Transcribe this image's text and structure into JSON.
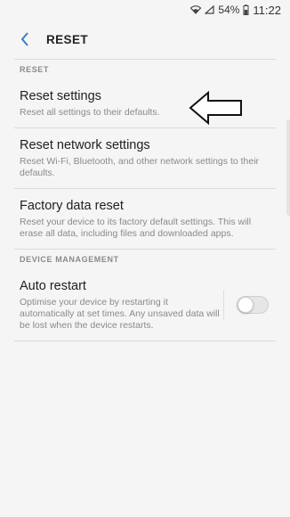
{
  "status_bar": {
    "battery": "54%",
    "time": "11:22",
    "icons": [
      "wifi-icon",
      "signal-icon",
      "battery-icon"
    ]
  },
  "app_bar": {
    "title": "RESET",
    "back_icon": "back-arrow-icon"
  },
  "sections": [
    {
      "header": "RESET",
      "items": [
        {
          "title": "Reset settings",
          "description": "Reset all settings to their defaults."
        },
        {
          "title": "Reset network settings",
          "description": "Reset Wi-Fi, Bluetooth, and other network settings to their defaults."
        },
        {
          "title": "Factory data reset",
          "description": "Reset your device to its factory default settings. This will erase all data, including files and downloaded apps."
        }
      ]
    },
    {
      "header": "DEVICE MANAGEMENT",
      "items": [
        {
          "title": "Auto restart",
          "description": "Optimise your device by restarting it automatically at set times. Any unsaved data will be lost when the device restarts.",
          "toggle": "off"
        }
      ]
    }
  ],
  "annotation": {
    "arrow_icon": "left-pointing-arrow-icon"
  },
  "colors": {
    "accent": "#3b7fc4",
    "background": "#f5f5f5",
    "secondary_text": "#8a8a8a"
  }
}
